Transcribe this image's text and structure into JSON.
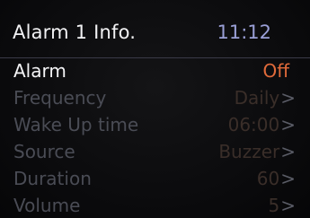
{
  "header": {
    "title": "Alarm 1 Info.",
    "time": "11:12"
  },
  "menu": {
    "items": [
      {
        "label": "Alarm",
        "value": "Off",
        "arrow": ""
      },
      {
        "label": "Frequency",
        "value": "Daily",
        "arrow": ">"
      },
      {
        "label": "Wake Up time",
        "value": "06:00",
        "arrow": ">"
      },
      {
        "label": "Source",
        "value": "Buzzer",
        "arrow": ">"
      },
      {
        "label": "Duration",
        "value": "60",
        "arrow": ">"
      },
      {
        "label": "Volume",
        "value": "5",
        "arrow": ">"
      }
    ]
  },
  "colors": {
    "accent_value": "#e06a3a",
    "clock": "#9a9fd6",
    "dim_label": "#4a4c55"
  }
}
